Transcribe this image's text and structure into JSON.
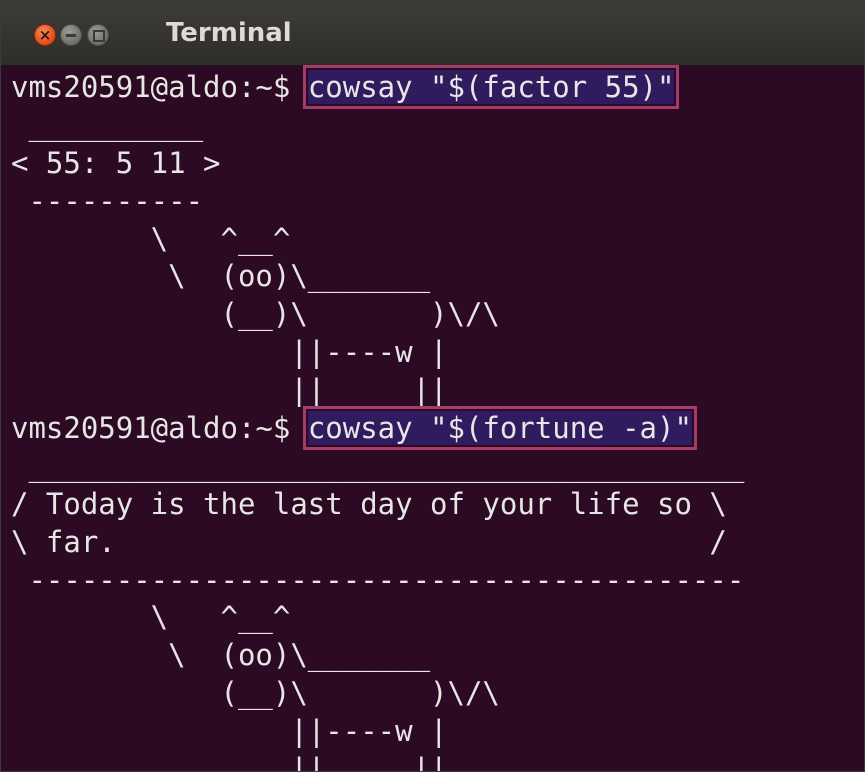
{
  "window": {
    "title": "Terminal"
  },
  "terminal": {
    "lines": [
      {
        "prompt": "vms20591@aldo:~$ ",
        "command": "cowsay \"$(factor 55)\""
      },
      {
        "text": " __________"
      },
      {
        "text": "< 55: 5 11 >"
      },
      {
        "text": " ----------"
      },
      {
        "text": "        \\   ^__^"
      },
      {
        "text": "         \\  (oo)\\_______"
      },
      {
        "text": "            (__)\\       )\\/\\"
      },
      {
        "text": "                ||----w |"
      },
      {
        "text": "                ||     ||"
      },
      {
        "prompt": "vms20591@aldo:~$ ",
        "command": "cowsay \"$(fortune -a)\""
      },
      {
        "text": " _________________________________________"
      },
      {
        "text": "/ Today is the last day of your life so \\"
      },
      {
        "text": "\\ far.                                  /"
      },
      {
        "text": " -----------------------------------------"
      },
      {
        "text": "        \\   ^__^"
      },
      {
        "text": "         \\  (oo)\\_______"
      },
      {
        "text": "            (__)\\       )\\/\\"
      },
      {
        "text": "                ||----w |"
      },
      {
        "text": "                ||     ||"
      }
    ]
  },
  "colors": {
    "terminal_bg": "#2c0a23",
    "terminal_fg": "#e6e6e6",
    "highlight_bg": "#2f1b5d",
    "highlight_border": "#a53b6a",
    "close_button": "#df4b16"
  },
  "icons": {
    "close": "close-icon",
    "minimize": "minimize-icon",
    "maximize": "maximize-icon"
  }
}
